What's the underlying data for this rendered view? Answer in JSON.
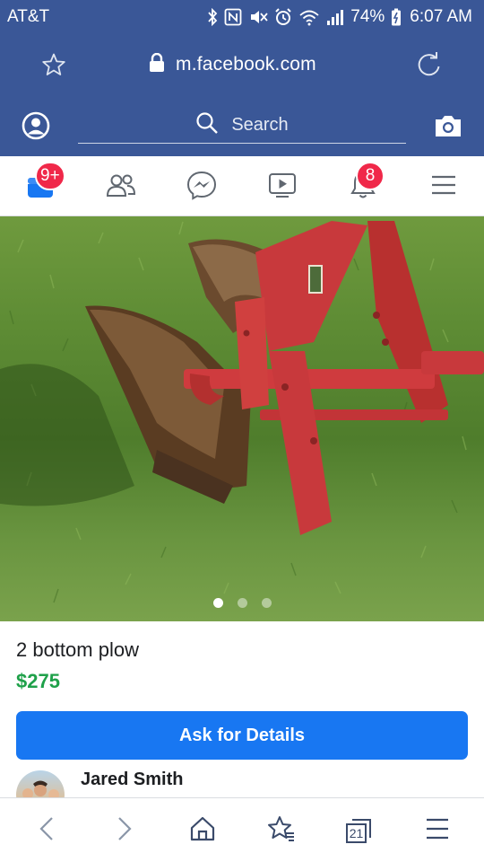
{
  "status_bar": {
    "carrier": "AT&T",
    "battery": "74%",
    "time": "6:07 AM"
  },
  "browser": {
    "url": "m.facebook.com",
    "tab_count": "21"
  },
  "fb_header": {
    "search_placeholder": "Search"
  },
  "fb_nav": {
    "marketplace_badge": "9+",
    "notifications_badge": "8"
  },
  "photo": {
    "current_index": 1,
    "total": 3
  },
  "listing": {
    "title": "2 bottom plow",
    "price": "$275",
    "ask_button_label": "Ask for Details",
    "seller_name": "Jared Smith"
  },
  "colors": {
    "facebook_blue": "#3a5797",
    "button_blue": "#1877f2",
    "badge_red": "#f02849",
    "price_green": "#1fa14a"
  },
  "icons": {
    "status": [
      "bluetooth-icon",
      "nfc-icon",
      "mute-icon",
      "alarm-icon",
      "wifi-icon",
      "signal-icon",
      "battery-icon"
    ],
    "nav": [
      "marketplace-icon",
      "friends-icon",
      "messenger-icon",
      "watch-icon",
      "notifications-icon",
      "menu-icon"
    ],
    "bottom": [
      "back-icon",
      "forward-icon",
      "home-icon",
      "bookmarks-icon",
      "tabs-icon",
      "browser-menu-icon"
    ]
  }
}
